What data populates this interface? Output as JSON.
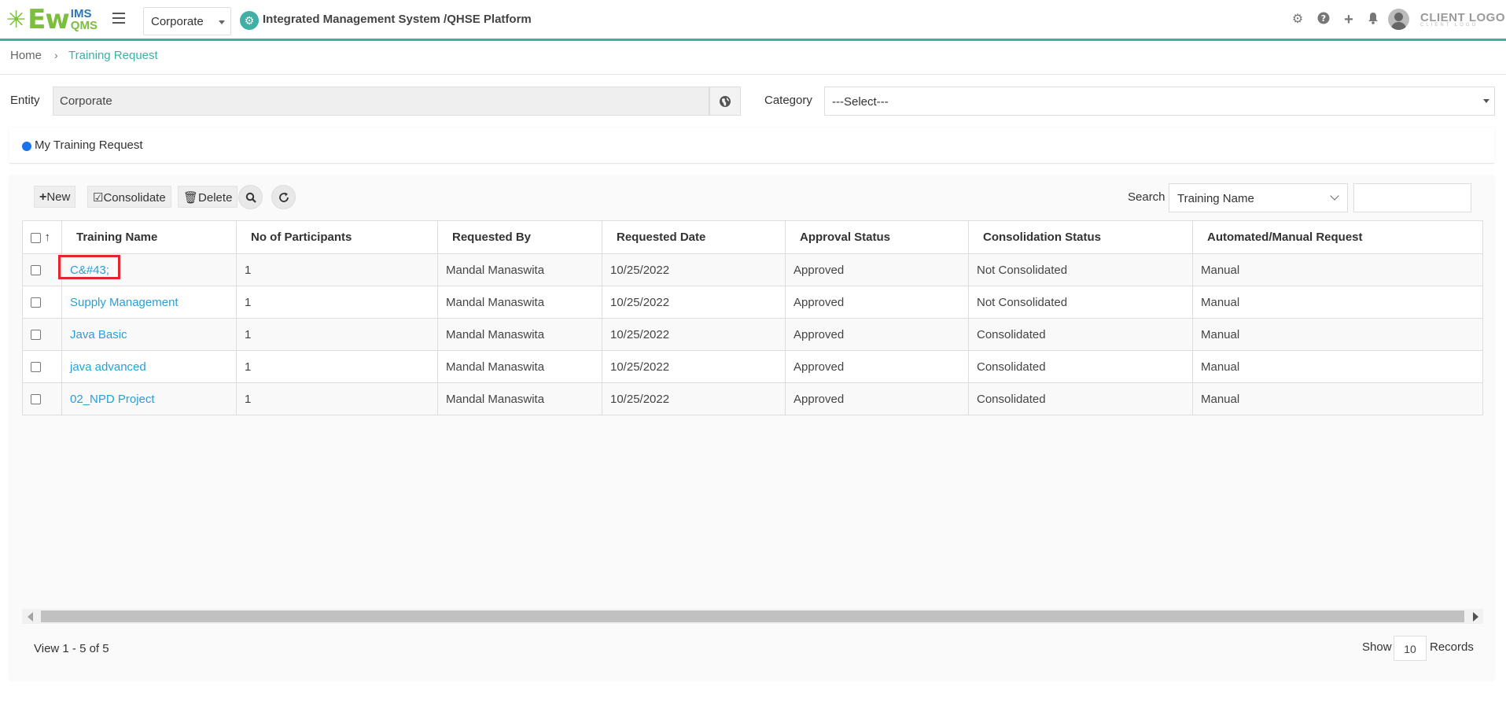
{
  "header": {
    "logo_main": "Ew",
    "logo_ims": "IMS",
    "logo_qms": "QMS",
    "entity_selected": "Corporate",
    "platform_title": "Integrated Management System /QHSE Platform",
    "client_logo": "CLIENT LOGO",
    "client_logo_sub": "CLIENT LOGO",
    "icons": [
      "gear-icon",
      "help-icon",
      "plus-icon",
      "bell-icon",
      "avatar"
    ]
  },
  "breadcrumb": {
    "home": "Home",
    "separator": "›",
    "current": "Training Request"
  },
  "filters": {
    "entity_label": "Entity",
    "entity_value": "Corporate",
    "category_label": "Category",
    "category_value": "---Select---"
  },
  "panel": {
    "title": "My Training Request"
  },
  "toolbar": {
    "new_label": "New",
    "consolidate_label": "Consolidate",
    "delete_label": "Delete",
    "search_label": "Search",
    "search_field": "Training Name",
    "search_value": ""
  },
  "table": {
    "sort_glyph": "↑",
    "columns": [
      "Training Name",
      "No of Participants",
      "Requested By",
      "Requested Date",
      "Approval Status",
      "Consolidation Status",
      "Automated/Manual Request"
    ],
    "rows": [
      {
        "name": "C&#43;",
        "participants": "1",
        "requested_by": "Mandal Manaswita",
        "date": "10/25/2022",
        "approval": "Approved",
        "consolidation": "Not Consolidated",
        "type": "Manual"
      },
      {
        "name": "Supply Management",
        "participants": "1",
        "requested_by": "Mandal Manaswita",
        "date": "10/25/2022",
        "approval": "Approved",
        "consolidation": "Not Consolidated",
        "type": "Manual"
      },
      {
        "name": "Java Basic",
        "participants": "1",
        "requested_by": "Mandal Manaswita",
        "date": "10/25/2022",
        "approval": "Approved",
        "consolidation": "Consolidated",
        "type": "Manual"
      },
      {
        "name": "java advanced",
        "participants": "1",
        "requested_by": "Mandal Manaswita",
        "date": "10/25/2022",
        "approval": "Approved",
        "consolidation": "Consolidated",
        "type": "Manual"
      },
      {
        "name": "02_NPD Project",
        "participants": "1",
        "requested_by": "Mandal Manaswita",
        "date": "10/25/2022",
        "approval": "Approved",
        "consolidation": "Consolidated",
        "type": "Manual"
      }
    ]
  },
  "pager": {
    "view_text": "View 1 - 5 of 5",
    "show_label": "Show",
    "show_value": "10",
    "records_label": "Records"
  },
  "colors": {
    "accent": "#3fb0a3",
    "link": "#2a9fd6",
    "highlight": "#e2262f",
    "dot": "#1a73e8"
  }
}
